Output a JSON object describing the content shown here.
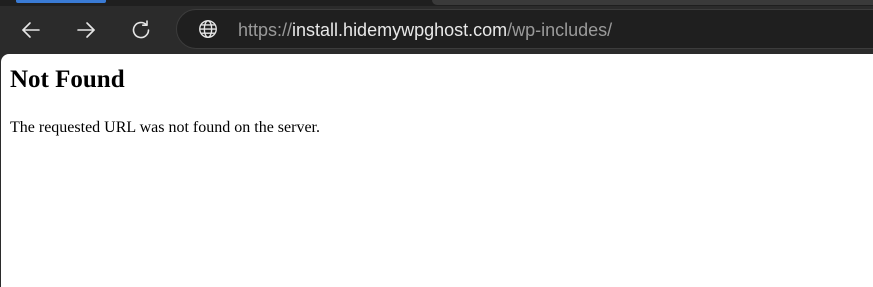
{
  "browser": {
    "toolbar": {
      "back_icon": "arrow-left-icon",
      "forward_icon": "arrow-right-icon",
      "refresh_icon": "refresh-icon"
    },
    "address_bar": {
      "icon": "globe-icon",
      "scheme": "https://",
      "host": "install.hidemywpghost.com",
      "path": "/wp-includes/"
    },
    "colors": {
      "chrome": "#2b2b2b",
      "omnibox": "#1f1f1f",
      "host_text": "#e8e8e8",
      "muted_text": "#9a9a9a",
      "page_background": "#ffffff"
    }
  },
  "page": {
    "heading": "Not Found",
    "message": "The requested URL was not found on the server."
  }
}
